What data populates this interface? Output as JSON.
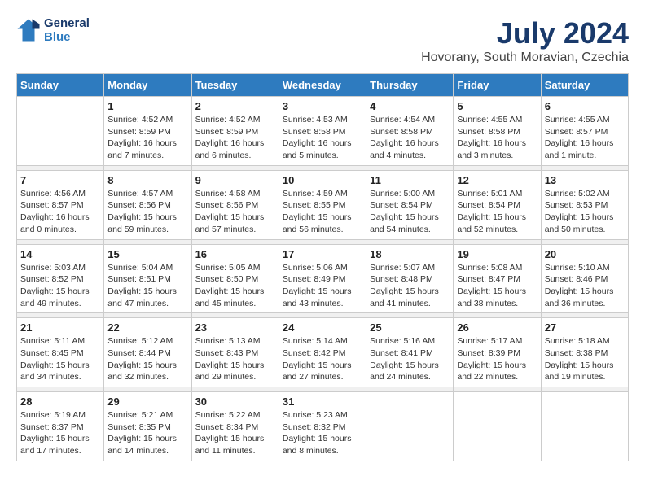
{
  "logo": {
    "line1": "General",
    "line2": "Blue"
  },
  "title": "July 2024",
  "subtitle": "Hovorany, South Moravian, Czechia",
  "weekdays": [
    "Sunday",
    "Monday",
    "Tuesday",
    "Wednesday",
    "Thursday",
    "Friday",
    "Saturday"
  ],
  "weeks": [
    [
      {
        "day": "",
        "info": ""
      },
      {
        "day": "1",
        "info": "Sunrise: 4:52 AM\nSunset: 8:59 PM\nDaylight: 16 hours\nand 7 minutes."
      },
      {
        "day": "2",
        "info": "Sunrise: 4:52 AM\nSunset: 8:59 PM\nDaylight: 16 hours\nand 6 minutes."
      },
      {
        "day": "3",
        "info": "Sunrise: 4:53 AM\nSunset: 8:58 PM\nDaylight: 16 hours\nand 5 minutes."
      },
      {
        "day": "4",
        "info": "Sunrise: 4:54 AM\nSunset: 8:58 PM\nDaylight: 16 hours\nand 4 minutes."
      },
      {
        "day": "5",
        "info": "Sunrise: 4:55 AM\nSunset: 8:58 PM\nDaylight: 16 hours\nand 3 minutes."
      },
      {
        "day": "6",
        "info": "Sunrise: 4:55 AM\nSunset: 8:57 PM\nDaylight: 16 hours\nand 1 minute."
      }
    ],
    [
      {
        "day": "7",
        "info": "Sunrise: 4:56 AM\nSunset: 8:57 PM\nDaylight: 16 hours\nand 0 minutes."
      },
      {
        "day": "8",
        "info": "Sunrise: 4:57 AM\nSunset: 8:56 PM\nDaylight: 15 hours\nand 59 minutes."
      },
      {
        "day": "9",
        "info": "Sunrise: 4:58 AM\nSunset: 8:56 PM\nDaylight: 15 hours\nand 57 minutes."
      },
      {
        "day": "10",
        "info": "Sunrise: 4:59 AM\nSunset: 8:55 PM\nDaylight: 15 hours\nand 56 minutes."
      },
      {
        "day": "11",
        "info": "Sunrise: 5:00 AM\nSunset: 8:54 PM\nDaylight: 15 hours\nand 54 minutes."
      },
      {
        "day": "12",
        "info": "Sunrise: 5:01 AM\nSunset: 8:54 PM\nDaylight: 15 hours\nand 52 minutes."
      },
      {
        "day": "13",
        "info": "Sunrise: 5:02 AM\nSunset: 8:53 PM\nDaylight: 15 hours\nand 50 minutes."
      }
    ],
    [
      {
        "day": "14",
        "info": "Sunrise: 5:03 AM\nSunset: 8:52 PM\nDaylight: 15 hours\nand 49 minutes."
      },
      {
        "day": "15",
        "info": "Sunrise: 5:04 AM\nSunset: 8:51 PM\nDaylight: 15 hours\nand 47 minutes."
      },
      {
        "day": "16",
        "info": "Sunrise: 5:05 AM\nSunset: 8:50 PM\nDaylight: 15 hours\nand 45 minutes."
      },
      {
        "day": "17",
        "info": "Sunrise: 5:06 AM\nSunset: 8:49 PM\nDaylight: 15 hours\nand 43 minutes."
      },
      {
        "day": "18",
        "info": "Sunrise: 5:07 AM\nSunset: 8:48 PM\nDaylight: 15 hours\nand 41 minutes."
      },
      {
        "day": "19",
        "info": "Sunrise: 5:08 AM\nSunset: 8:47 PM\nDaylight: 15 hours\nand 38 minutes."
      },
      {
        "day": "20",
        "info": "Sunrise: 5:10 AM\nSunset: 8:46 PM\nDaylight: 15 hours\nand 36 minutes."
      }
    ],
    [
      {
        "day": "21",
        "info": "Sunrise: 5:11 AM\nSunset: 8:45 PM\nDaylight: 15 hours\nand 34 minutes."
      },
      {
        "day": "22",
        "info": "Sunrise: 5:12 AM\nSunset: 8:44 PM\nDaylight: 15 hours\nand 32 minutes."
      },
      {
        "day": "23",
        "info": "Sunrise: 5:13 AM\nSunset: 8:43 PM\nDaylight: 15 hours\nand 29 minutes."
      },
      {
        "day": "24",
        "info": "Sunrise: 5:14 AM\nSunset: 8:42 PM\nDaylight: 15 hours\nand 27 minutes."
      },
      {
        "day": "25",
        "info": "Sunrise: 5:16 AM\nSunset: 8:41 PM\nDaylight: 15 hours\nand 24 minutes."
      },
      {
        "day": "26",
        "info": "Sunrise: 5:17 AM\nSunset: 8:39 PM\nDaylight: 15 hours\nand 22 minutes."
      },
      {
        "day": "27",
        "info": "Sunrise: 5:18 AM\nSunset: 8:38 PM\nDaylight: 15 hours\nand 19 minutes."
      }
    ],
    [
      {
        "day": "28",
        "info": "Sunrise: 5:19 AM\nSunset: 8:37 PM\nDaylight: 15 hours\nand 17 minutes."
      },
      {
        "day": "29",
        "info": "Sunrise: 5:21 AM\nSunset: 8:35 PM\nDaylight: 15 hours\nand 14 minutes."
      },
      {
        "day": "30",
        "info": "Sunrise: 5:22 AM\nSunset: 8:34 PM\nDaylight: 15 hours\nand 11 minutes."
      },
      {
        "day": "31",
        "info": "Sunrise: 5:23 AM\nSunset: 8:32 PM\nDaylight: 15 hours\nand 8 minutes."
      },
      {
        "day": "",
        "info": ""
      },
      {
        "day": "",
        "info": ""
      },
      {
        "day": "",
        "info": ""
      }
    ]
  ]
}
